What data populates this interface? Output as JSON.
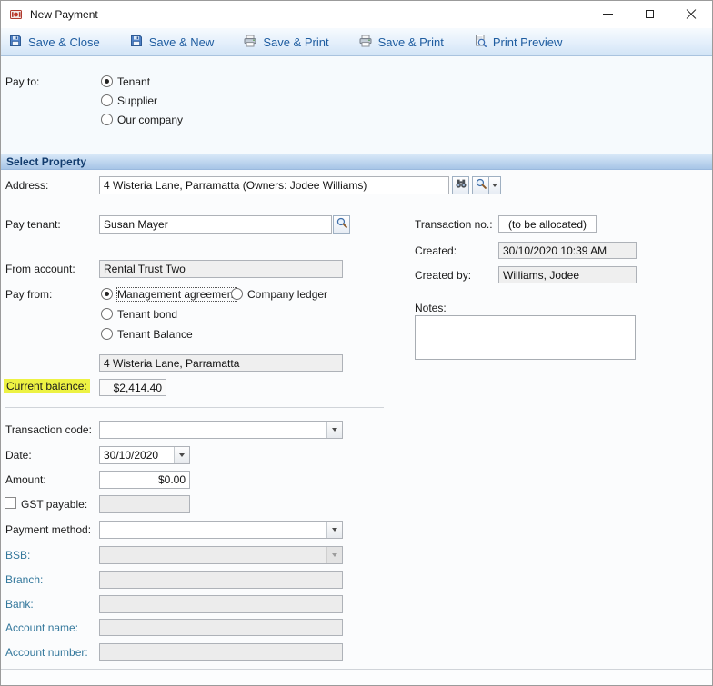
{
  "window": {
    "title": "New Payment"
  },
  "toolbar": {
    "items": [
      {
        "label": "Save & Close"
      },
      {
        "label": "Save & New"
      },
      {
        "label": "Save & Print"
      },
      {
        "label": "Save & Print"
      },
      {
        "label": "Print Preview"
      }
    ]
  },
  "pay_to": {
    "label": "Pay to:",
    "options": [
      {
        "label": "Tenant",
        "selected": true
      },
      {
        "label": "Supplier",
        "selected": false
      },
      {
        "label": "Our company",
        "selected": false
      }
    ]
  },
  "section": {
    "title": "Select Property"
  },
  "form": {
    "address": {
      "label": "Address:",
      "value": "4 Wisteria Lane, Parramatta (Owners: Jodee Williams)"
    },
    "pay_tenant": {
      "label": "Pay tenant:",
      "value": "Susan Mayer"
    },
    "from_account": {
      "label": "From account:",
      "value": "Rental Trust Two"
    },
    "pay_from": {
      "label": "Pay from:",
      "options": [
        {
          "label": "Management agreement",
          "selected": true
        },
        {
          "label": "Company ledger",
          "selected": false
        },
        {
          "label": "Tenant bond",
          "selected": false
        },
        {
          "label": "Tenant Balance",
          "selected": false
        }
      ],
      "property_value": "4 Wisteria Lane, Parramatta"
    },
    "current_balance": {
      "label": "Current balance:",
      "value": "$2,414.40"
    },
    "transaction_code": {
      "label": "Transaction code:",
      "value": ""
    },
    "date": {
      "label": "Date:",
      "value": "30/10/2020"
    },
    "amount": {
      "label": "Amount:",
      "value": "$0.00"
    },
    "gst_payable": {
      "label": "GST payable:",
      "value": "",
      "checked": false
    },
    "payment_method": {
      "label": "Payment method:",
      "value": ""
    },
    "bsb": {
      "label": "BSB:",
      "value": ""
    },
    "branch": {
      "label": "Branch:",
      "value": ""
    },
    "bank": {
      "label": "Bank:",
      "value": ""
    },
    "account_name": {
      "label": "Account name:",
      "value": ""
    },
    "account_number": {
      "label": "Account number:",
      "value": ""
    }
  },
  "details": {
    "transaction_no": {
      "label": "Transaction no.:",
      "value": "(to be allocated)"
    },
    "created": {
      "label": "Created:",
      "value": "30/10/2020 10:39 AM"
    },
    "created_by": {
      "label": "Created by:",
      "value": "Williams, Jodee"
    },
    "notes": {
      "label": "Notes:",
      "value": ""
    }
  },
  "colors": {
    "toolbar_text": "#1f5da0",
    "section_header_text": "#123c6e",
    "field_label_accent": "#34789c",
    "balance_highlight": "#edf243"
  }
}
